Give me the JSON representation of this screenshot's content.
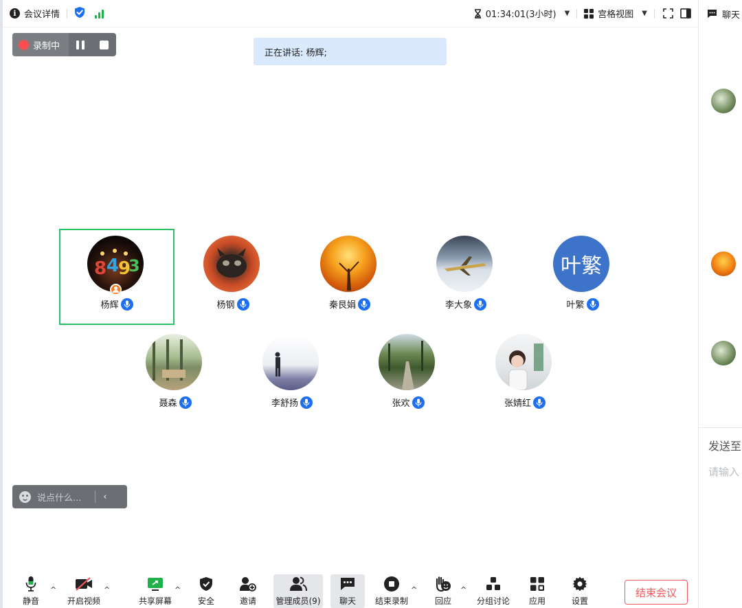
{
  "topbar": {
    "meeting_details": "会议详情",
    "timer": "01:34:01(3小时)",
    "view_mode": "宫格视图"
  },
  "recording": {
    "label": "录制中"
  },
  "speaking": {
    "text": "正在讲话: 杨辉;"
  },
  "participants": [
    {
      "name": "杨辉"
    },
    {
      "name": "杨钢"
    },
    {
      "name": "秦艮娟"
    },
    {
      "name": "李大象"
    },
    {
      "name": "叶繁",
      "avatar_text": "叶繁"
    },
    {
      "name": "聂森"
    },
    {
      "name": "李舒扬"
    },
    {
      "name": "张欢"
    },
    {
      "name": "张婧红"
    }
  ],
  "chat_box": {
    "placeholder": "说点什么..."
  },
  "chat_panel": {
    "title": "聊天",
    "send_to": "发送至",
    "input_placeholder": "请输入"
  },
  "toolbar": {
    "mute": "静音",
    "video": "开启视频",
    "share": "共享屏幕",
    "security": "安全",
    "invite": "邀请",
    "members": "管理成员(9)",
    "chat": "聊天",
    "stop_record": "结束录制",
    "react": "回应",
    "breakout": "分组讨论",
    "apps": "应用",
    "settings": "设置",
    "end_meeting": "结束会议"
  },
  "colors": {
    "accent_blue": "#1e6ff0",
    "active_green": "#27c266",
    "end_red": "#f0595b",
    "signal_green": "#20b14a"
  }
}
